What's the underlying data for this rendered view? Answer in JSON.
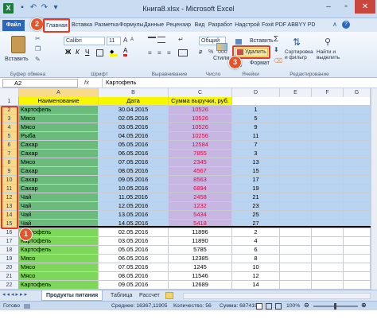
{
  "window": {
    "title": "Книга8.xlsx - Microsoft Excel"
  },
  "ribbon_tabs": [
    "Файл",
    "Главная",
    "Вставка",
    "Разметка",
    "Формулы",
    "Данные",
    "Рецензир",
    "Вид",
    "Разработ",
    "Надстрой",
    "Foxit PDF",
    "ABBYY PD"
  ],
  "ribbon": {
    "paste_label": "Вставить",
    "font_name": "Calibri",
    "font_size": "11",
    "number_format": "Общий",
    "styles_label": "Стили",
    "insert_label": "Вставить",
    "delete_label": "Удалить",
    "format_label": "Формат",
    "sort_label": "Сортировка и фильтр",
    "find_label": "Найти и выделить",
    "sigma": "Σ",
    "groups": {
      "clipboard": "Буфер обмена",
      "font": "Шрифт",
      "alignment": "Выравнивание",
      "number": "Число",
      "cells": "Ячейки",
      "editing": "Редактирование"
    }
  },
  "formula_bar": {
    "name_box": "A2",
    "fx": "fx",
    "value": "Картофель"
  },
  "columns": [
    "A",
    "B",
    "C",
    "D",
    "E",
    "F",
    "G"
  ],
  "headers": {
    "a": "Наименование",
    "b": "Дата",
    "c": "Сумма выручки, руб."
  },
  "rows": [
    {
      "n": "2",
      "a": "Картофель",
      "b": "30.04.2015",
      "c": "10526",
      "d": "1"
    },
    {
      "n": "3",
      "a": "Мясо",
      "b": "02.05.2016",
      "c": "10526",
      "d": "5"
    },
    {
      "n": "4",
      "a": "Мясо",
      "b": "03.05.2016",
      "c": "10526",
      "d": "9"
    },
    {
      "n": "5",
      "a": "Рыба",
      "b": "04.05.2016",
      "c": "10256",
      "d": "11"
    },
    {
      "n": "6",
      "a": "Сахар",
      "b": "05.05.2016",
      "c": "12584",
      "d": "7"
    },
    {
      "n": "7",
      "a": "Сахар",
      "b": "06.05.2016",
      "c": "7855",
      "d": "3"
    },
    {
      "n": "8",
      "a": "Мясо",
      "b": "07.05.2016",
      "c": "2345",
      "d": "13"
    },
    {
      "n": "9",
      "a": "Сахар",
      "b": "08.05.2016",
      "c": "4567",
      "d": "15"
    },
    {
      "n": "10",
      "a": "Сахар",
      "b": "09.05.2016",
      "c": "8563",
      "d": "17"
    },
    {
      "n": "11",
      "a": "Сахар",
      "b": "10.05.2016",
      "c": "6894",
      "d": "19"
    },
    {
      "n": "12",
      "a": "Чай",
      "b": "11.05.2016",
      "c": "2458",
      "d": "21"
    },
    {
      "n": "13",
      "a": "Чай",
      "b": "12.05.2016",
      "c": "1232",
      "d": "23"
    },
    {
      "n": "14",
      "a": "Чай",
      "b": "13.05.2016",
      "c": "5434",
      "d": "25"
    },
    {
      "n": "15",
      "a": "Чай",
      "b": "14.05.2016",
      "c": "5418",
      "d": "27"
    },
    {
      "n": "16",
      "a": "Картофель",
      "b": "02.05.2016",
      "c": "11896",
      "d": "2"
    },
    {
      "n": "17",
      "a": "Картофель",
      "b": "03.05.2016",
      "c": "11890",
      "d": "4"
    },
    {
      "n": "18",
      "a": "Картофель",
      "b": "05.05.2016",
      "c": "5785",
      "d": "6"
    },
    {
      "n": "19",
      "a": "Мясо",
      "b": "06.05.2016",
      "c": "12385",
      "d": "8"
    },
    {
      "n": "20",
      "a": "Мясо",
      "b": "07.05.2016",
      "c": "1245",
      "d": "10"
    },
    {
      "n": "21",
      "a": "Мясо",
      "b": "08.05.2016",
      "c": "11546",
      "d": "12"
    },
    {
      "n": "22",
      "a": "Картофель",
      "b": "09.05.2016",
      "c": "12689",
      "d": "14"
    }
  ],
  "sheet_tabs": [
    "Продукты питания",
    "Таблица",
    "Рассчет"
  ],
  "status": {
    "ready": "Готово",
    "average": "Среднее: 16367,11905",
    "count": "Количество: 56",
    "sum": "Сумма: 687419",
    "zoom": "100%"
  },
  "markers": [
    "1",
    "2",
    "3"
  ],
  "colors": {
    "green_fill": "#6abb7c",
    "blue_fill": "#b8d4f0",
    "purple_fill": "#c8b6e2",
    "yellow_fill": "#f7f700",
    "lime_fill": "#7ed65a",
    "marker": "#e8542a",
    "red_text": "#c0134d"
  }
}
